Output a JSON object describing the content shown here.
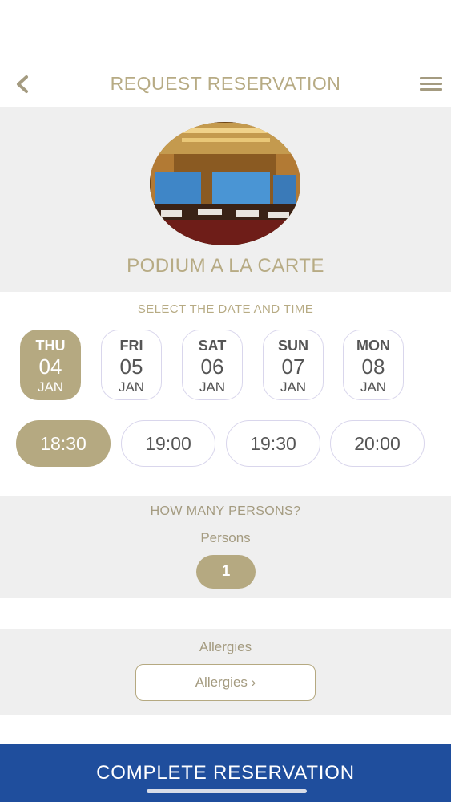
{
  "header": {
    "title": "REQUEST RESERVATION",
    "back_icon": "chevron-left-icon",
    "menu_icon": "hamburger-menu-icon"
  },
  "hero": {
    "restaurant_name": "PODIUM A LA CARTE"
  },
  "dates": {
    "label": "SELECT THE DATE AND TIME",
    "items": [
      {
        "dow": "THU",
        "day": "04",
        "month": "JAN",
        "selected": true
      },
      {
        "dow": "FRI",
        "day": "05",
        "month": "JAN",
        "selected": false
      },
      {
        "dow": "SAT",
        "day": "06",
        "month": "JAN",
        "selected": false
      },
      {
        "dow": "SUN",
        "day": "07",
        "month": "JAN",
        "selected": false
      },
      {
        "dow": "MON",
        "day": "08",
        "month": "JAN",
        "selected": false
      }
    ]
  },
  "times": {
    "items": [
      {
        "label": "18:30",
        "selected": true
      },
      {
        "label": "19:00",
        "selected": false
      },
      {
        "label": "19:30",
        "selected": false
      },
      {
        "label": "20:00",
        "selected": false
      }
    ]
  },
  "persons": {
    "label": "HOW MANY PERSONS?",
    "sublabel": "Persons",
    "value": "1"
  },
  "allergies": {
    "label": "Allergies",
    "button_label": "Allergies ›"
  },
  "cta": {
    "label": "COMPLETE RESERVATION"
  },
  "colors": {
    "accent": "#b5a981",
    "cta": "#1f4e9d",
    "section_bg": "#efefef"
  }
}
